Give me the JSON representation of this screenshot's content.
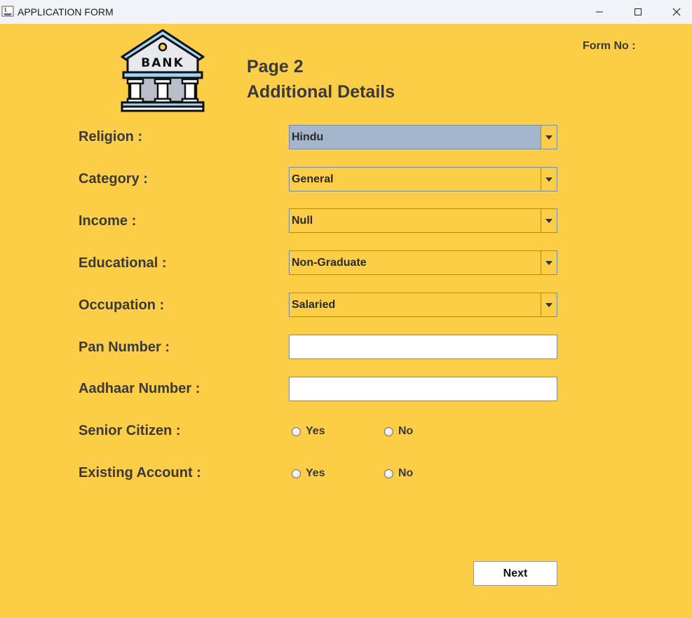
{
  "window": {
    "title": "APPLICATION FORM",
    "minimize_icon": "minimize-icon",
    "maximize_icon": "maximize-icon",
    "close_icon": "close-icon"
  },
  "header": {
    "logo_text": "BANK",
    "page_title": "Page 2",
    "page_subtitle": "Additional Details",
    "form_no_label": "Form No :"
  },
  "form": {
    "religion": {
      "label": "Religion :",
      "value": "Hindu"
    },
    "category": {
      "label": "Category :",
      "value": "General"
    },
    "income": {
      "label": "Income :",
      "value": "Null"
    },
    "education": {
      "label": "Educational :",
      "value": "Non-Graduate"
    },
    "occupation": {
      "label": "Occupation :",
      "value": "Salaried"
    },
    "pan": {
      "label": "Pan Number :",
      "value": ""
    },
    "aadhaar": {
      "label": "Aadhaar Number :",
      "value": ""
    },
    "senior_citizen": {
      "label": "Senior Citizen :",
      "yes": "Yes",
      "no": "No"
    },
    "existing_account": {
      "label": "Existing Account :",
      "yes": "Yes",
      "no": "No"
    }
  },
  "actions": {
    "next_label": "Next"
  },
  "colors": {
    "background": "#fccd47",
    "selected_combo": "#a3b6cc",
    "text": "#3a3a3a"
  }
}
